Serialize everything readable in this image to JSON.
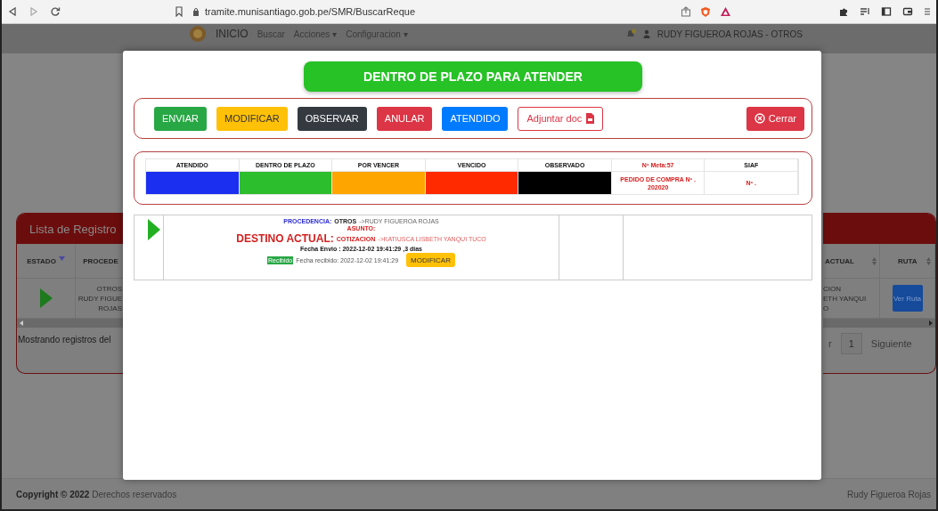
{
  "browser": {
    "url": "tramite.munisantiago.gob.pe/SMR/BuscarReque"
  },
  "navbar": {
    "items": [
      "INICIO",
      "Buscar",
      "Acciones ▾",
      "Configuracion ▾"
    ],
    "user": "RUDY FIGUEROA ROJAS - OTROS"
  },
  "list_left": {
    "title": "Lista de Registro",
    "columns": [
      "ESTADO",
      "PROCEDE"
    ],
    "cell_lines": [
      "OTROS",
      "RUDY FIGUE",
      "ROJAS"
    ],
    "info": "Mostrando registros del"
  },
  "list_right": {
    "columns": [
      "ACTUAL",
      "RUTA"
    ],
    "cell_lines": [
      "CION",
      "ETH YANQUI",
      "O"
    ],
    "route_button": "Ver Ruta",
    "pagination": [
      "r",
      "1",
      "Siguiente"
    ]
  },
  "modal": {
    "status_title": "DENTRO DE PLAZO PARA ATENDER",
    "actions": [
      {
        "label": "ENVIAR",
        "kind": "success"
      },
      {
        "label": "MODIFICAR",
        "kind": "warning"
      },
      {
        "label": "OBSERVAR",
        "kind": "dark"
      },
      {
        "label": "ANULAR",
        "kind": "danger"
      },
      {
        "label": "ATENDIDO",
        "kind": "primary"
      },
      {
        "label": "Adjuntar doc",
        "kind": "outline"
      }
    ],
    "close": "Cerrar",
    "legend": [
      {
        "header": "ATENDIDO",
        "kind": "swatch",
        "color": "#1a2ff0"
      },
      {
        "header": "DENTRO DE PLAZO",
        "kind": "swatch",
        "color": "#2dbe2d"
      },
      {
        "header": "POR VENCER",
        "kind": "swatch",
        "color": "#ffa500"
      },
      {
        "header": "VENCIDO",
        "kind": "swatch",
        "color": "#ff2a00"
      },
      {
        "header": "OBSERVADO",
        "kind": "swatch",
        "color": "#000000"
      },
      {
        "header": "Nº Meta:57",
        "kind": "text",
        "highlight": true,
        "value": "PEDIDO DE COMPRA Nº . 202020"
      },
      {
        "header": "SIAF",
        "kind": "text",
        "highlight": false,
        "value": "Nº ."
      }
    ],
    "record": {
      "procedencia_label": "PROCEDENCIA:",
      "procedencia_tipo": "OTROS",
      "procedencia_nombre": "->RUDY FIGUEROA ROJAS",
      "asunto_label": "ASUNTO:",
      "destino_label": "DESTINO ACTUAL:",
      "destino_tipo": "COTIZACION",
      "destino_nombre": "->KATIUSCA LISBETH YANQUI TUCO",
      "fecha_envio": "Fecha Envio : 2022-12-02 19:41:29 ,3 dias",
      "status_badge": "Recibido",
      "fecha_recibido": "Fecha recibido: 2022-12-02 19:41:29",
      "action": "MODIFICAR"
    }
  },
  "footer": {
    "left": "**Copyright © 2022** Derechos reservados",
    "right": "Rudy Figueroa Rojas"
  }
}
